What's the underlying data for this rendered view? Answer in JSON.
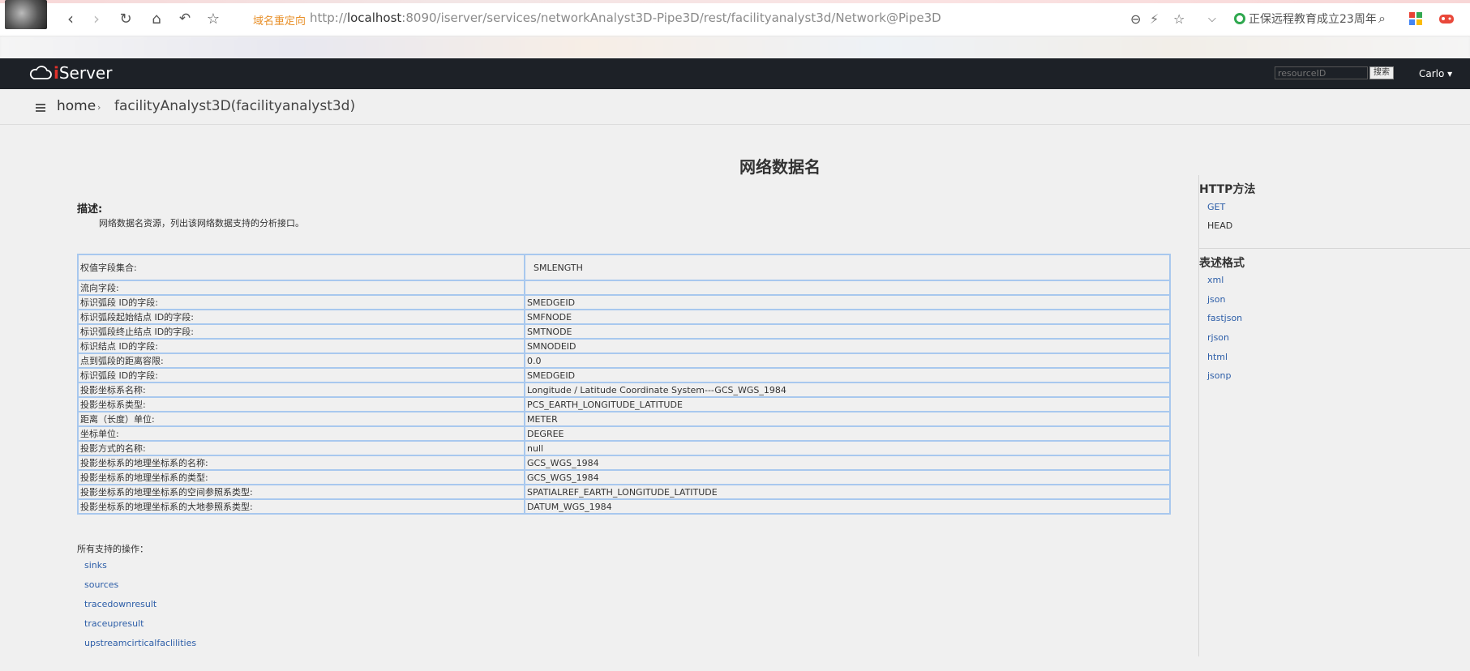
{
  "browser": {
    "redirect_label": "域名重定向",
    "url_prefix": "http://",
    "url_host": "localhost",
    "url_rest": ":8090/iserver/services/networkAnalyst3D-Pipe3D/rest/facilityanalyst3d/Network@Pipe3D",
    "news_text": "正保远程教育成立23周年"
  },
  "header": {
    "brand_i": "i",
    "brand_rest": "Server",
    "search_placeholder": "resourceID",
    "search_button": "搜索",
    "user": "Carlo ▾"
  },
  "breadcrumb": {
    "home": "home",
    "sep": "›",
    "current": "facilityAnalyst3D(facilityanalyst3d)"
  },
  "main": {
    "title": "网络数据名",
    "desc_label": "描述:",
    "desc_text": "网络数据名资源，列出该网络数据支持的分析接口。",
    "rows": [
      {
        "k": "权值字段集合:",
        "v": "SMLENGTH"
      },
      {
        "k": "流向字段:",
        "v": ""
      },
      {
        "k": "标识弧段 ID的字段:",
        "v": "SMEDGEID"
      },
      {
        "k": "标识弧段起始结点 ID的字段:",
        "v": "SMFNODE"
      },
      {
        "k": "标识弧段终止结点 ID的字段:",
        "v": "SMTNODE"
      },
      {
        "k": "标识结点 ID的字段:",
        "v": "SMNODEID"
      },
      {
        "k": "点到弧段的距离容限:",
        "v": "0.0"
      },
      {
        "k": "标识弧段 ID的字段:",
        "v": "SMEDGEID"
      },
      {
        "k": "投影坐标系名称:",
        "v": "Longitude / Latitude Coordinate System---GCS_WGS_1984"
      },
      {
        "k": "投影坐标系类型:",
        "v": "PCS_EARTH_LONGITUDE_LATITUDE"
      },
      {
        "k": "距离（长度）单位:",
        "v": "METER"
      },
      {
        "k": "坐标单位:",
        "v": "DEGREE"
      },
      {
        "k": "投影方式的名称:",
        "v": "null"
      },
      {
        "k": "投影坐标系的地理坐标系的名称:",
        "v": "GCS_WGS_1984"
      },
      {
        "k": "投影坐标系的地理坐标系的类型:",
        "v": "GCS_WGS_1984"
      },
      {
        "k": "投影坐标系的地理坐标系的空间参照系类型:",
        "v": "SPATIALREF_EARTH_LONGITUDE_LATITUDE"
      },
      {
        "k": "投影坐标系的地理坐标系的大地参照系类型:",
        "v": "DATUM_WGS_1984"
      }
    ],
    "ops_label": "所有支持的操作：",
    "ops": [
      "sinks",
      "sources",
      "tracedownresult",
      "traceupresult",
      "upstreamcirticalfaclilities"
    ]
  },
  "sidebar": {
    "http_title": "HTTP方法",
    "methods": [
      "GET",
      "HEAD"
    ],
    "format_title": "表述格式",
    "formats": [
      "xml",
      "json",
      "fastjson",
      "rjson",
      "html",
      "jsonp"
    ]
  }
}
